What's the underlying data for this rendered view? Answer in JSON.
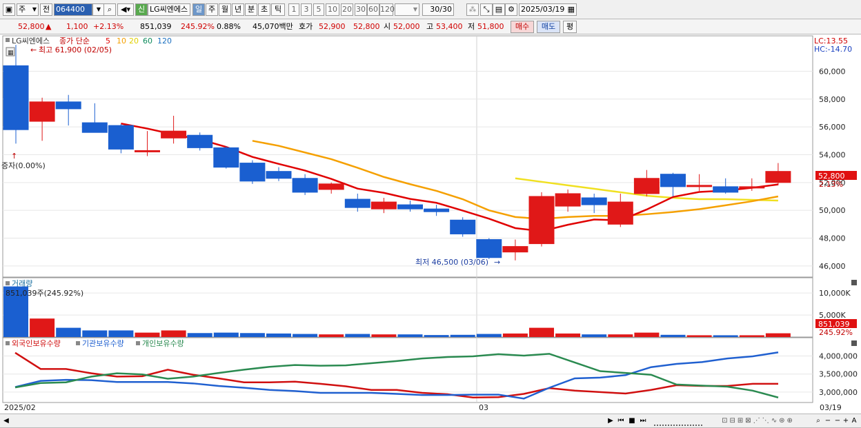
{
  "toolbar": {
    "period_select": "주",
    "prev_label": "전",
    "code": "064400",
    "name_badge": "신",
    "stock_name": "LG씨엔에스",
    "period_tabs": [
      "일",
      "주",
      "월",
      "년",
      "분",
      "초",
      "틱"
    ],
    "active_tab": "일",
    "minute_steps": [
      "1",
      "3",
      "5",
      "10",
      "20",
      "30",
      "60",
      "120"
    ],
    "count": "30/30",
    "date": "2025/03/19"
  },
  "infobar": {
    "price": "52,800",
    "change_mark": "▲",
    "change": "1,100",
    "change_pct": "+2.13%",
    "volume": "851,039",
    "volume_ratio": "245.92%",
    "turnover": "0.88%",
    "amount": "45,070백만",
    "ask_label": "호가",
    "ask": "52,900",
    "bid": "52,800",
    "open_label": "시",
    "open": "52,000",
    "high_label": "고",
    "high": "53,400",
    "low_label": "저",
    "low": "51,800",
    "buy_label": "매수",
    "sell_label": "매도",
    "avg_label": "평"
  },
  "price_panel": {
    "legend_name": "LG씨엔에스",
    "legend_ma": "종가 단순",
    "ma_periods": [
      "5",
      "10",
      "20",
      "60",
      "120"
    ],
    "ma_colors": [
      "#e00000",
      "#f5a000",
      "#e8e800",
      "#0a8a5a",
      "#1a6fc0"
    ],
    "lc_label": "LC:13.55",
    "hc_label": "HC:-14.70",
    "high_note": "최고 61,900 (02/05)",
    "low_note": "최저 46,500 (03/06)",
    "capital_note": "증자(0.00%)",
    "current_price_tag": "52,800",
    "current_pct_tag": "2.13%"
  },
  "volume_panel": {
    "title": "거래량",
    "info": "851,039주(245.92%)",
    "tag_value": "851,039",
    "tag_pct": "245.92%"
  },
  "holding_panel": {
    "legend": [
      "외국인보유수량",
      "기관보유수량",
      "개인보유수량"
    ],
    "colors": [
      "#d01010",
      "#2060d0",
      "#2a8a50"
    ]
  },
  "axis": {
    "start_label": "2025/02",
    "mid_label": "03",
    "end_label": "03/19"
  },
  "chart_data": {
    "type": "candlestick",
    "price": {
      "ticks": [
        46000,
        48000,
        50000,
        52000,
        54000,
        56000,
        58000,
        60000
      ],
      "tick_labels": [
        "46,000",
        "48,000",
        "50,000",
        "52,000",
        "54,000",
        "56,000",
        "58,000",
        "60,000"
      ],
      "ylim": [
        45200,
        62400
      ],
      "candles": [
        {
          "o": 60400,
          "h": 61900,
          "l": 54800,
          "c": 55800
        },
        {
          "o": 56400,
          "h": 58100,
          "l": 55000,
          "c": 57800
        },
        {
          "o": 57800,
          "h": 58300,
          "l": 56100,
          "c": 57300
        },
        {
          "o": 56300,
          "h": 57700,
          "l": 55800,
          "c": 55600
        },
        {
          "o": 56100,
          "h": 56200,
          "l": 54100,
          "c": 54400
        },
        {
          "o": 54200,
          "h": 55700,
          "l": 53900,
          "c": 54300
        },
        {
          "o": 55200,
          "h": 56800,
          "l": 54800,
          "c": 55700
        },
        {
          "o": 55400,
          "h": 55600,
          "l": 54300,
          "c": 54500
        },
        {
          "o": 54500,
          "h": 54600,
          "l": 53000,
          "c": 53100
        },
        {
          "o": 53400,
          "h": 53600,
          "l": 51900,
          "c": 52100
        },
        {
          "o": 52800,
          "h": 53100,
          "l": 52100,
          "c": 52300
        },
        {
          "o": 52300,
          "h": 52600,
          "l": 51100,
          "c": 51300
        },
        {
          "o": 51500,
          "h": 52000,
          "l": 51200,
          "c": 51900
        },
        {
          "o": 50800,
          "h": 51200,
          "l": 49900,
          "c": 50200
        },
        {
          "o": 50100,
          "h": 50900,
          "l": 49800,
          "c": 50600
        },
        {
          "o": 50400,
          "h": 50700,
          "l": 49900,
          "c": 50100
        },
        {
          "o": 50100,
          "h": 50400,
          "l": 49600,
          "c": 49900
        },
        {
          "o": 49300,
          "h": 49500,
          "l": 48100,
          "c": 48300
        },
        {
          "o": 47900,
          "h": 48000,
          "l": 46500,
          "c": 46600
        },
        {
          "o": 47000,
          "h": 47900,
          "l": 46400,
          "c": 47400
        },
        {
          "o": 47600,
          "h": 51300,
          "l": 47400,
          "c": 51000
        },
        {
          "o": 50300,
          "h": 51500,
          "l": 49900,
          "c": 51200
        },
        {
          "o": 50900,
          "h": 51200,
          "l": 49800,
          "c": 50400
        },
        {
          "o": 49000,
          "h": 51200,
          "l": 48800,
          "c": 50600
        },
        {
          "o": 51200,
          "h": 52900,
          "l": 51000,
          "c": 52300
        },
        {
          "o": 52600,
          "h": 52700,
          "l": 51000,
          "c": 51700
        },
        {
          "o": 51700,
          "h": 52600,
          "l": 51400,
          "c": 51800
        },
        {
          "o": 51700,
          "h": 52300,
          "l": 51200,
          "c": 51300
        },
        {
          "o": 51700,
          "h": 52300,
          "l": 51400,
          "c": 51700
        },
        {
          "o": 52000,
          "h": 53400,
          "l": 51800,
          "c": 52800
        }
      ],
      "ma5": [
        null,
        null,
        null,
        null,
        56240,
        55880,
        55460,
        55100,
        54560,
        53840,
        53340,
        52860,
        52260,
        51560,
        51260,
        50820,
        50540,
        49980,
        49400,
        48720,
        48500,
        48960,
        49340,
        49280,
        50060,
        50960,
        51320,
        51420,
        51620,
        51860
      ],
      "ma10": [
        null,
        null,
        null,
        null,
        null,
        null,
        null,
        null,
        null,
        55000,
        54640,
        54160,
        53680,
        53060,
        52400,
        51880,
        51400,
        50800,
        50000,
        49520,
        49380,
        49520,
        49600,
        49600,
        49720,
        49880,
        50080,
        50360,
        50650,
        51000
      ],
      "ma20": [
        null,
        null,
        null,
        null,
        null,
        null,
        null,
        null,
        null,
        null,
        null,
        null,
        null,
        null,
        null,
        null,
        null,
        null,
        null,
        52300,
        52050,
        51800,
        51550,
        51300,
        51050,
        50900,
        50800,
        50800,
        50750,
        50700
      ]
    },
    "volume": {
      "ticks": [
        5000000,
        10000000
      ],
      "tick_labels": [
        "5,000K",
        "10,000K"
      ],
      "ylim": [
        0,
        13000000
      ],
      "values": [
        11500000,
        4200000,
        2100000,
        1500000,
        1500000,
        1000000,
        1500000,
        900000,
        1000000,
        900000,
        800000,
        700000,
        600000,
        700000,
        600000,
        600000,
        450000,
        500000,
        700000,
        800000,
        2100000,
        800000,
        600000,
        600000,
        1000000,
        500000,
        400000,
        400000,
        400000,
        851039
      ]
    },
    "holdings": {
      "ticks": [
        3000000,
        3500000,
        4000000
      ],
      "tick_labels": [
        "3,000,000",
        "3,500,000",
        "4,000,000"
      ],
      "ylim": [
        2750000,
        4200000
      ],
      "series": [
        {
          "name": "외국인보유수량",
          "values": [
            4090000,
            3640000,
            3640000,
            3520000,
            3430000,
            3440000,
            3620000,
            3480000,
            3380000,
            3270000,
            3270000,
            3290000,
            3230000,
            3160000,
            3060000,
            3060000,
            2980000,
            2940000,
            2850000,
            2860000,
            2950000,
            3110000,
            3040000,
            3000000,
            2960000,
            3060000,
            3190000,
            3170000,
            3170000,
            3230000,
            3230000
          ]
        },
        {
          "name": "기관보유수량",
          "values": [
            3140000,
            3310000,
            3340000,
            3330000,
            3280000,
            3280000,
            3280000,
            3240000,
            3170000,
            3120000,
            3060000,
            3030000,
            2980000,
            2980000,
            2980000,
            2950000,
            2920000,
            2920000,
            2930000,
            2930000,
            2820000,
            3120000,
            3380000,
            3400000,
            3470000,
            3690000,
            3780000,
            3830000,
            3930000,
            3990000,
            4100000
          ]
        },
        {
          "name": "개인보유수량",
          "values": [
            3130000,
            3250000,
            3270000,
            3430000,
            3520000,
            3490000,
            3370000,
            3430000,
            3530000,
            3620000,
            3700000,
            3750000,
            3730000,
            3740000,
            3800000,
            3860000,
            3930000,
            3970000,
            3990000,
            4050000,
            4010000,
            4060000,
            3820000,
            3580000,
            3530000,
            3480000,
            3210000,
            3180000,
            3150000,
            3040000,
            2850000
          ]
        }
      ]
    }
  }
}
